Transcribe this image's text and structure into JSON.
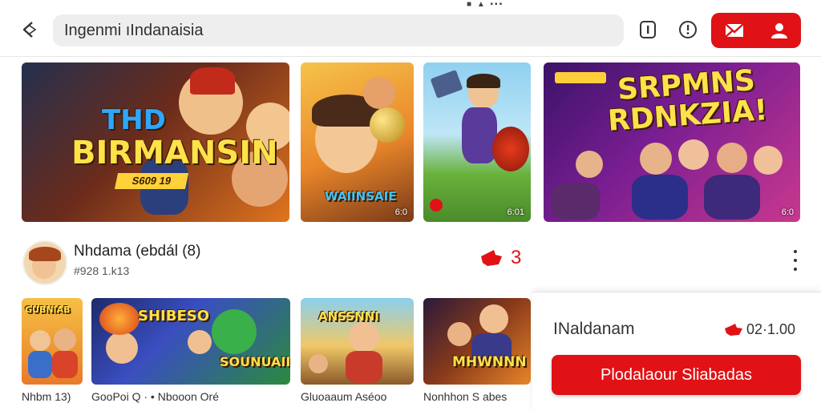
{
  "header": {
    "search_value": "Ingenmi ıIndanaisia",
    "status": "■ ▲ ▪▪▪",
    "icons": [
      "back-arrow-icon",
      "info-icon",
      "clock-icon",
      "flag-icon",
      "user-icon"
    ]
  },
  "featured": [
    {
      "title_line1": "THD",
      "title_line2": "BIRMANSIN",
      "tag": "S609 19"
    },
    {
      "title": "WAIINSAIE",
      "duration": "6:0"
    },
    {
      "duration": "6:01"
    },
    {
      "title_line1": "SRPMNS",
      "title_line2": "RDNKZIA!",
      "duration": "6:0"
    }
  ],
  "channel": {
    "name": "Nhdama (ebdál (8)",
    "subtitle": "#928 1.k13",
    "likes": "3"
  },
  "row2": [
    {
      "title": "GUBNIAB",
      "caption": "Nhbm 13)"
    },
    {
      "title": "SHIBESO",
      "subtitle": "SOUNUAII",
      "caption": "GooPoi Q · • Nbooon Oré"
    },
    {
      "title": "ANSSNNI",
      "caption": "Gluoaaum Aséoo"
    },
    {
      "title": "MHWNNN",
      "caption": "Nonhhon S abes"
    }
  ],
  "panel": {
    "title": "INaldanam",
    "price": "02·1.00",
    "button_label": "Plodalaour Sliabadas"
  },
  "colors": {
    "accent": "#e01216",
    "search_bg": "#eeeeee"
  }
}
